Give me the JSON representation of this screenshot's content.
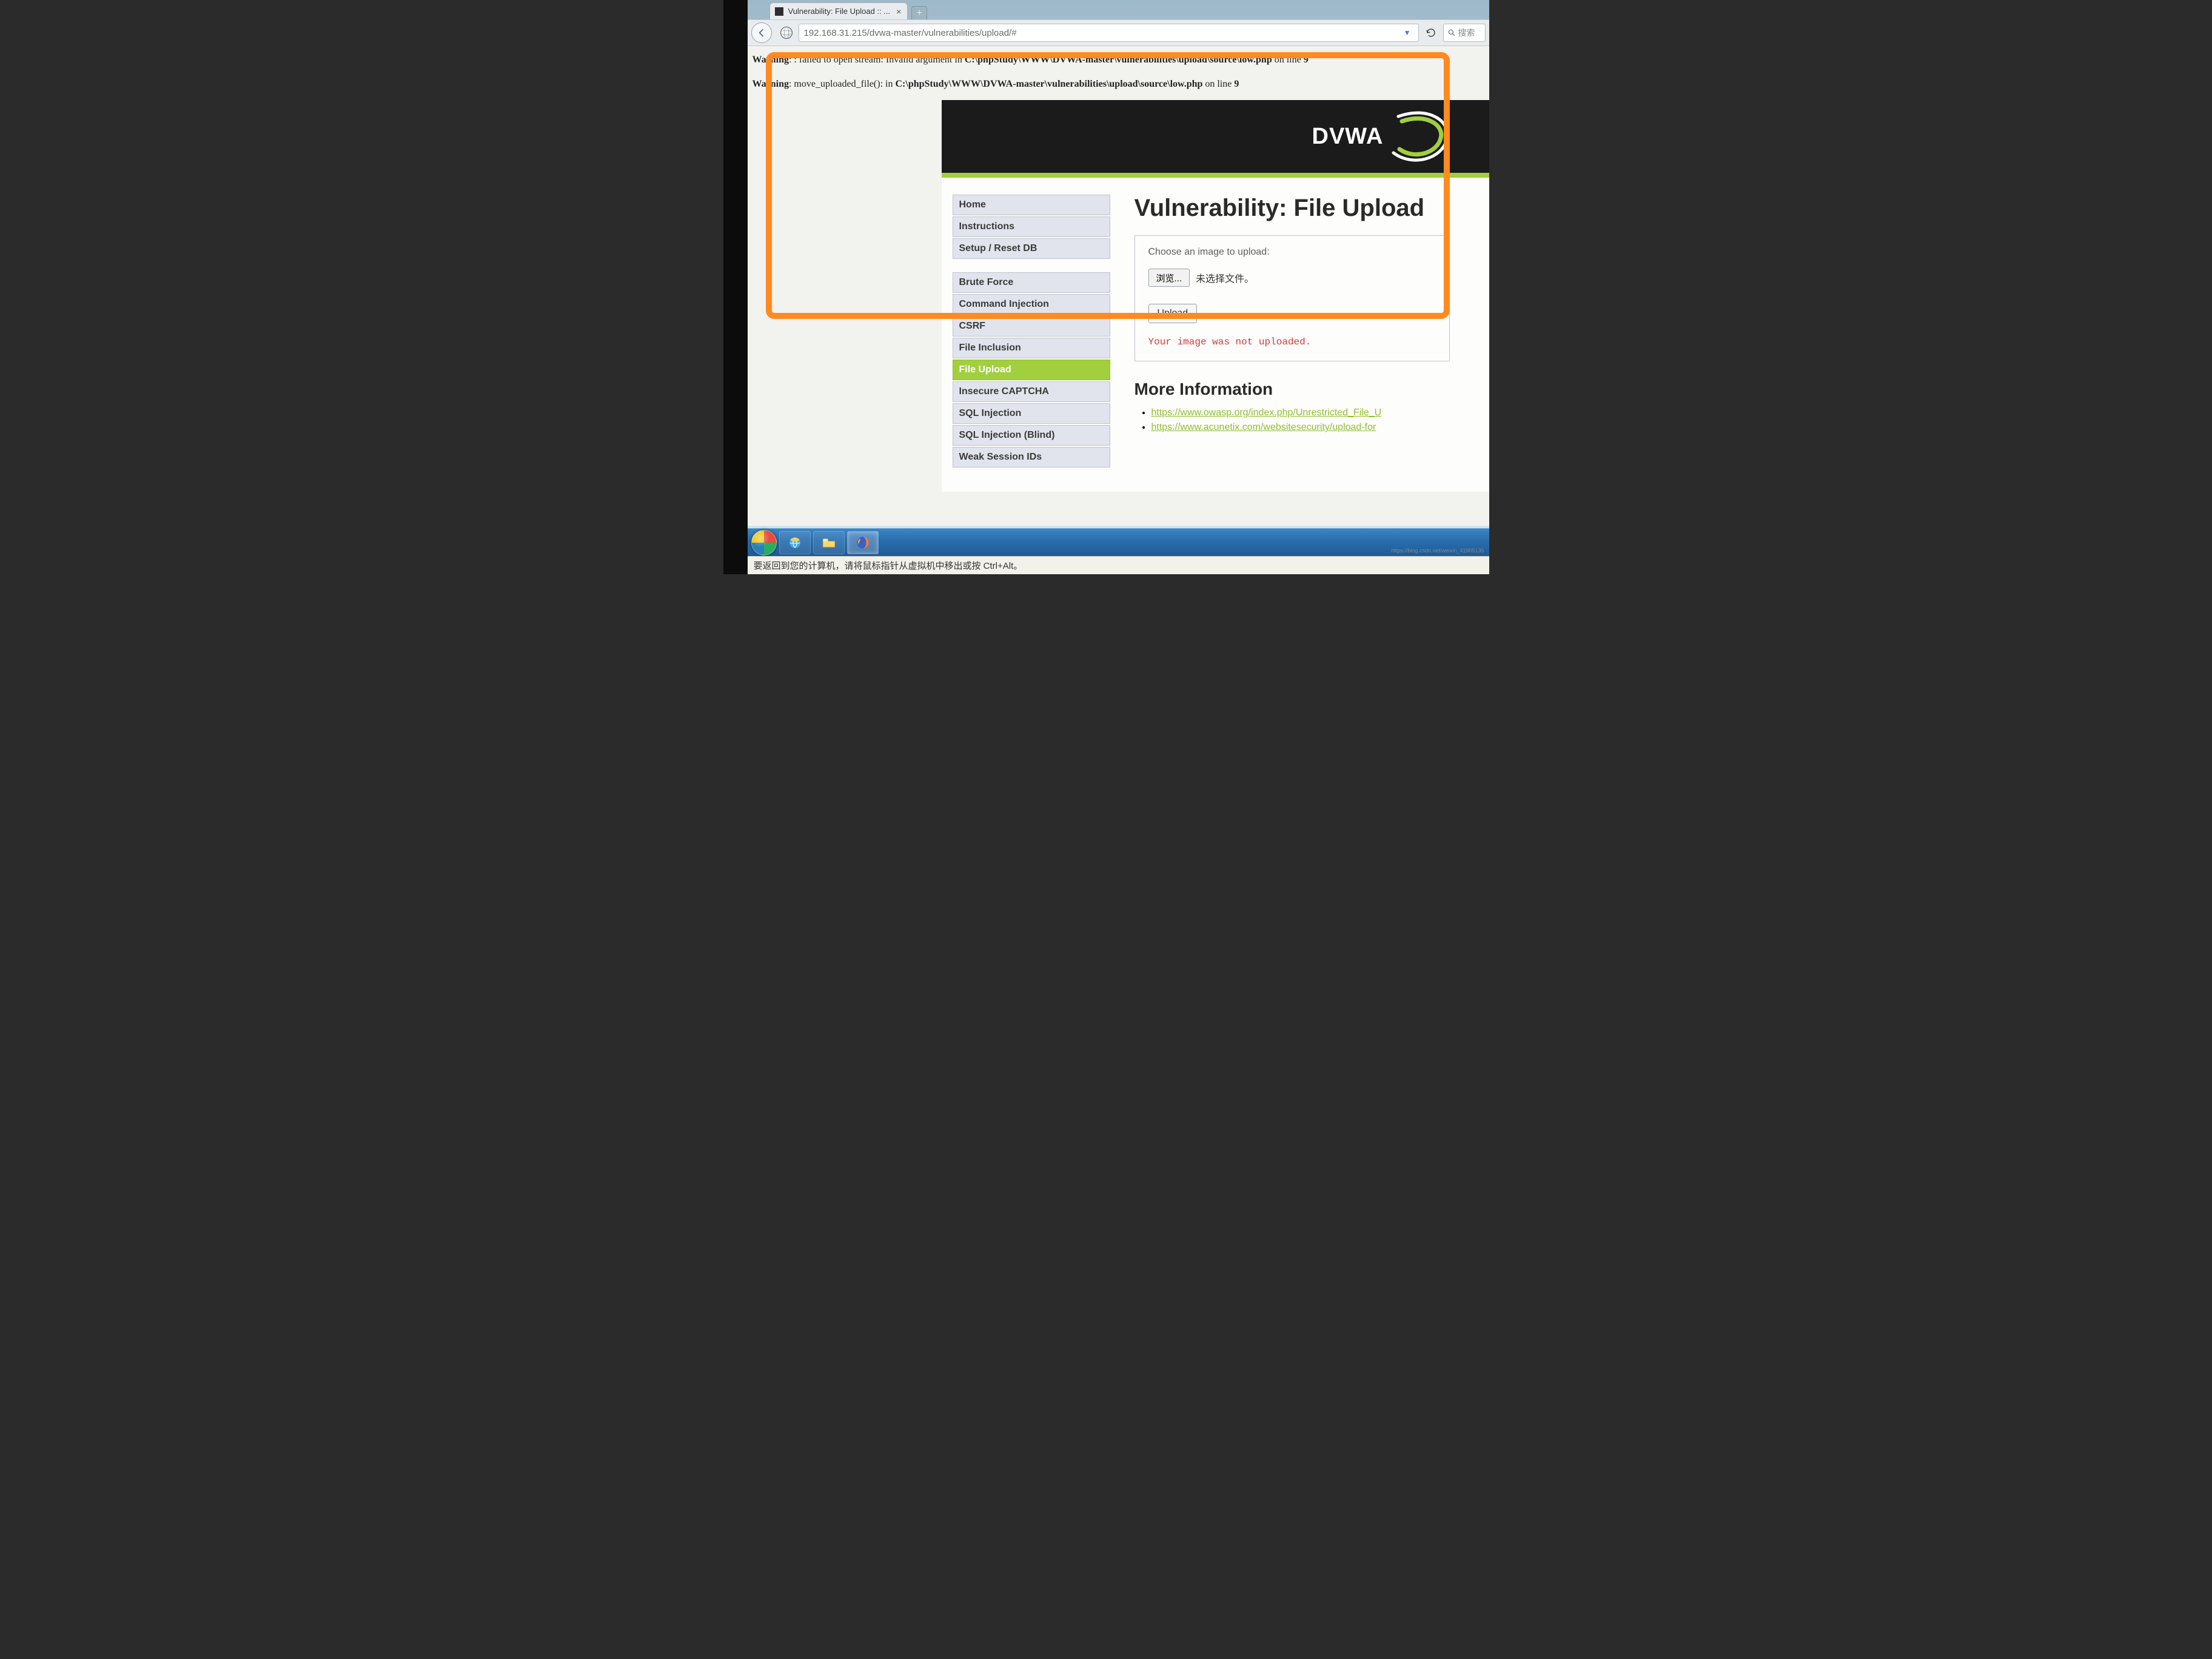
{
  "browser": {
    "tab_title": "Vulnerability: File Upload :: ...",
    "new_tab_glyph": "+",
    "close_glyph": "×",
    "url": "192.168.31.215/dvwa-master/vulnerabilities/upload/#",
    "search_placeholder": "搜索"
  },
  "php_warnings": {
    "w1_label": "Warning",
    "w1_msg": ": : failed to open stream: Invalid argument in ",
    "w1_path": "C:\\phpStudy\\WWW\\DVWA-master\\vulnerabilities\\upload\\source\\low.php",
    "w1_tail": " on line ",
    "w1_line": "9",
    "w2_label": "Warning",
    "w2_msg": ": move_uploaded_file(): in ",
    "w2_path": "C:\\phpStudy\\WWW\\DVWA-master\\vulnerabilities\\upload\\source\\low.php",
    "w2_tail": " on line ",
    "w2_line": "9"
  },
  "logo_text": "DVWA",
  "sidebar": {
    "home": "Home",
    "instructions": "Instructions",
    "setup": "Setup / Reset DB",
    "bruteforce": "Brute Force",
    "cmdi": "Command Injection",
    "csrf": "CSRF",
    "fi": "File Inclusion",
    "fu": "File Upload",
    "captcha": "Insecure CAPTCHA",
    "sqli": "SQL Injection",
    "sqlib": "SQL Injection (Blind)",
    "weak": "Weak Session IDs"
  },
  "main": {
    "heading": "Vulnerability: File Upload",
    "prompt": "Choose an image to upload:",
    "browse_label": "浏览...",
    "nofile_label": "未选择文件。",
    "upload_label": "Upload",
    "error_msg": "Your image was not uploaded.",
    "more_info_heading": "More Information",
    "link1": "https://www.owasp.org/index.php/Unrestricted_File_U",
    "link2": "https://www.acunetix.com/websitesecurity/upload-for"
  },
  "taskbar": {
    "hint": "要返回到您的计算机，请将鼠标指针从虚拟机中移出或按 Ctrl+Alt。"
  },
  "watermark": "https://blog.csdn.net/weixin_41905135"
}
